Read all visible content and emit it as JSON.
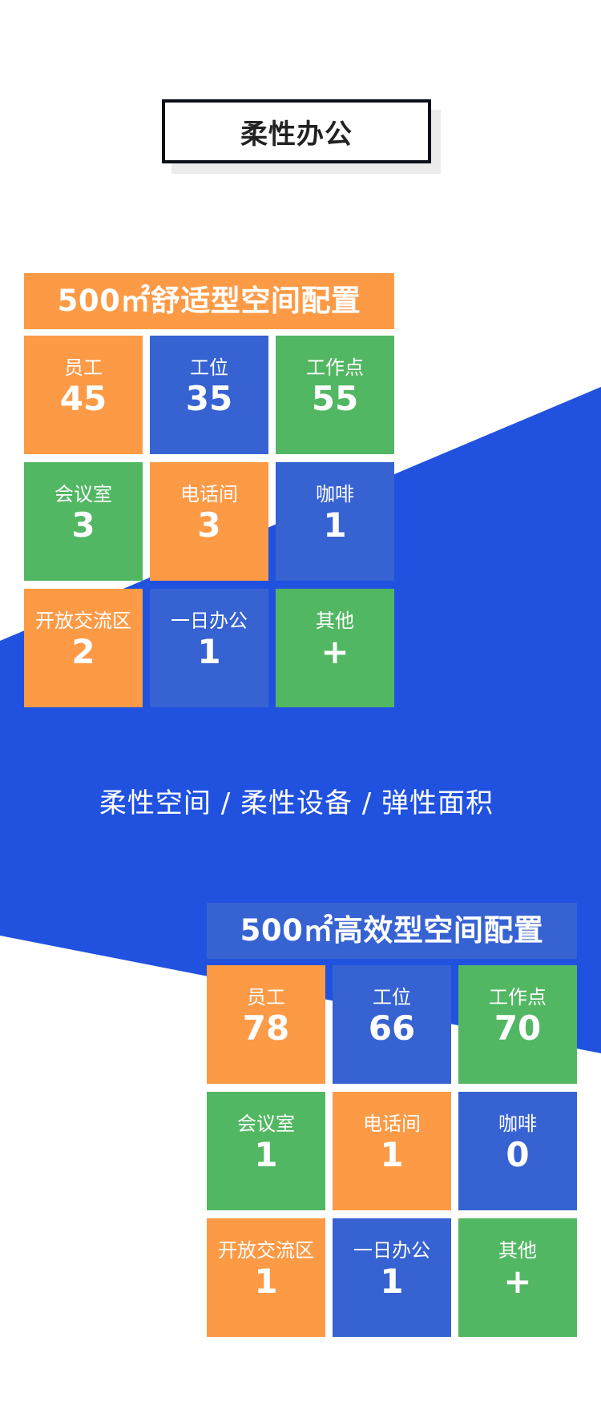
{
  "colors": {
    "background": "#ffffff",
    "band": "#2052df",
    "orange": "#fd9a46",
    "blue": "#3662d2",
    "green": "#52b762",
    "text_on_tile": "#ffffff"
  },
  "title": "柔性办公",
  "tagline": "柔性空间 / 柔性设备 / 弹性面积",
  "panels": [
    {
      "header": "500㎡舒适型空间配置",
      "header_color": "orange",
      "tiles": [
        {
          "label": "员工",
          "value": "45",
          "color": "orange"
        },
        {
          "label": "工位",
          "value": "35",
          "color": "blue"
        },
        {
          "label": "工作点",
          "value": "55",
          "color": "green"
        },
        {
          "label": "会议室",
          "value": "3",
          "color": "green"
        },
        {
          "label": "电话间",
          "value": "3",
          "color": "orange"
        },
        {
          "label": "咖啡",
          "value": "1",
          "color": "blue"
        },
        {
          "label": "开放交流区",
          "value": "2",
          "color": "orange"
        },
        {
          "label": "一日办公",
          "value": "1",
          "color": "blue"
        },
        {
          "label": "其他",
          "value": "+",
          "color": "green"
        }
      ]
    },
    {
      "header": "500㎡高效型空间配置",
      "header_color": "blue",
      "tiles": [
        {
          "label": "员工",
          "value": "78",
          "color": "orange"
        },
        {
          "label": "工位",
          "value": "66",
          "color": "blue"
        },
        {
          "label": "工作点",
          "value": "70",
          "color": "green"
        },
        {
          "label": "会议室",
          "value": "1",
          "color": "green"
        },
        {
          "label": "电话间",
          "value": "1",
          "color": "orange"
        },
        {
          "label": "咖啡",
          "value": "0",
          "color": "blue"
        },
        {
          "label": "开放交流区",
          "value": "1",
          "color": "orange"
        },
        {
          "label": "一日办公",
          "value": "1",
          "color": "blue"
        },
        {
          "label": "其他",
          "value": "+",
          "color": "green"
        }
      ]
    }
  ]
}
